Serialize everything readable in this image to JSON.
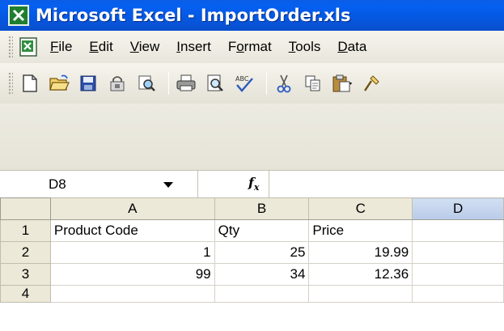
{
  "window": {
    "title": "Microsoft Excel - ImportOrder.xls",
    "icon": "excel-icon",
    "title_color": "#0558e6"
  },
  "menu": {
    "items": [
      {
        "label": "File",
        "accel": "F"
      },
      {
        "label": "Edit",
        "accel": "E"
      },
      {
        "label": "View",
        "accel": "V"
      },
      {
        "label": "Insert",
        "accel": "I"
      },
      {
        "label": "Format",
        "accel": "o"
      },
      {
        "label": "Tools",
        "accel": "T"
      },
      {
        "label": "Data",
        "accel": "D"
      }
    ]
  },
  "toolbar": {
    "buttons": [
      "new-icon",
      "open-icon",
      "save-icon",
      "permission-icon",
      "search-icon",
      "print-icon",
      "print-preview-icon",
      "spelling-icon",
      "cut-icon",
      "copy-icon",
      "paste-icon",
      "format-painter-icon"
    ]
  },
  "formula_bar": {
    "name_box": "D8",
    "fx_label": "fx",
    "formula": ""
  },
  "sheet": {
    "columns": [
      "A",
      "B",
      "C",
      "D"
    ],
    "selected_column": "D",
    "rows": [
      {
        "num": "1",
        "cells": [
          "Product Code",
          "Qty",
          "Price",
          ""
        ]
      },
      {
        "num": "2",
        "cells": [
          "1",
          "25",
          "19.99",
          ""
        ]
      },
      {
        "num": "3",
        "cells": [
          "99",
          "34",
          "12.36",
          ""
        ]
      },
      {
        "num": "4",
        "cells": [
          "",
          "",
          "",
          ""
        ]
      }
    ]
  }
}
